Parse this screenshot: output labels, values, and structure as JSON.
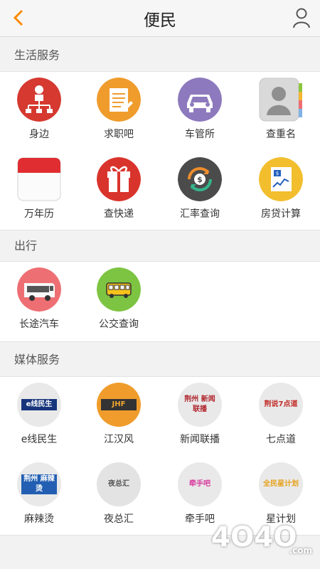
{
  "header": {
    "title": "便民",
    "back_icon": "chevron-left-icon",
    "user_icon": "user-icon"
  },
  "sections": [
    {
      "title": "生活服务",
      "items": [
        {
          "label": "身边",
          "icon": "nearby-icon",
          "color": "#d53930"
        },
        {
          "label": "求职吧",
          "icon": "job-icon",
          "color": "#ef9c2c"
        },
        {
          "label": "车管所",
          "icon": "car-icon",
          "color": "#8d79bd"
        },
        {
          "label": "查重名",
          "icon": "contact-icon",
          "color": "#9e9e9e"
        },
        {
          "label": "万年历",
          "icon": "calendar-icon",
          "color": "#df2d31"
        },
        {
          "label": "查快递",
          "icon": "gift-icon",
          "color": "#d9342c"
        },
        {
          "label": "汇率查询",
          "icon": "currency-exchange-icon",
          "color": "#4b4b4b"
        },
        {
          "label": "房贷计算",
          "icon": "mortgage-icon",
          "color": "#f2be2d"
        }
      ]
    },
    {
      "title": "出行",
      "items": [
        {
          "label": "长途汽车",
          "icon": "coach-bus-icon",
          "color": "#ee6f73"
        },
        {
          "label": "公交查询",
          "icon": "city-bus-icon",
          "color": "#7dc442"
        }
      ]
    },
    {
      "title": "媒体服务",
      "items": [
        {
          "label": "e线民生",
          "icon": "eline-logo-icon",
          "color": "#18357c",
          "logo_text": "e线民生"
        },
        {
          "label": "江汉风",
          "icon": "jianghanfeng-logo-icon",
          "color": "#e48922",
          "logo_text": "JHF"
        },
        {
          "label": "新闻联播",
          "icon": "news-logo-icon",
          "color": "#b1272e",
          "logo_text": "荆州 新闻联播"
        },
        {
          "label": "七点道",
          "icon": "seven-logo-icon",
          "color": "#c12c27",
          "logo_text": "荆说7点道"
        },
        {
          "label": "麻辣烫",
          "icon": "malatang-logo-icon",
          "color": "#225fb2",
          "logo_text": "荆州 麻辣烫"
        },
        {
          "label": "夜总汇",
          "icon": "night-logo-icon",
          "color": "#444444",
          "logo_text": "夜总汇"
        },
        {
          "label": "牵手吧",
          "icon": "hand-logo-icon",
          "color": "#d83c9e",
          "logo_text": "牵手吧"
        },
        {
          "label": "星计划",
          "icon": "star-logo-icon",
          "color": "#e6a21c",
          "logo_text": "全民星计划"
        }
      ]
    }
  ],
  "watermark": {
    "main": "4O4O",
    "sub": ".com"
  }
}
